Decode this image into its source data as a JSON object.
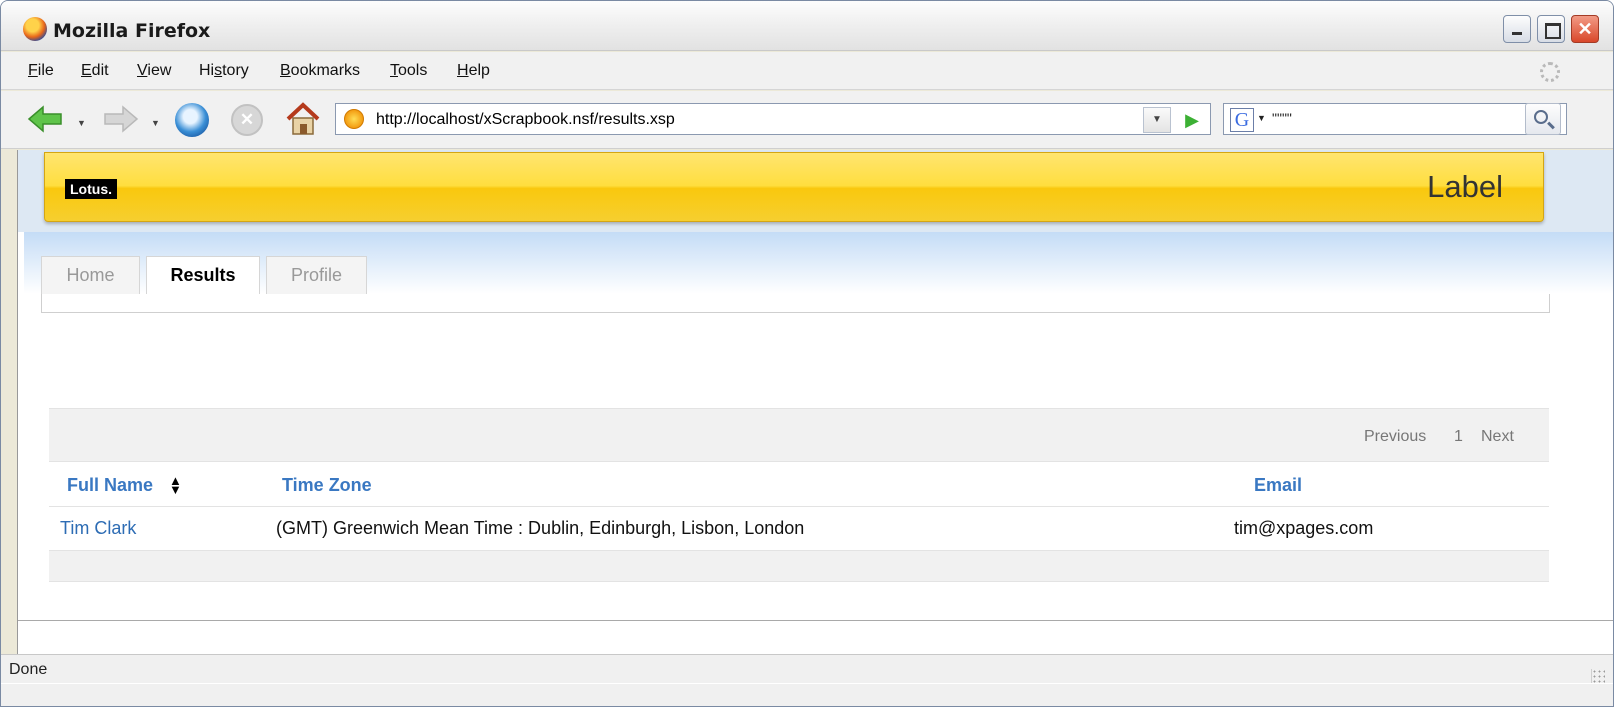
{
  "window": {
    "title": "Mozilla Firefox"
  },
  "menu": {
    "items": [
      {
        "pre": "",
        "u": "F",
        "post": "ile"
      },
      {
        "pre": "",
        "u": "E",
        "post": "dit"
      },
      {
        "pre": "",
        "u": "V",
        "post": "iew"
      },
      {
        "pre": "Hi",
        "u": "s",
        "post": "tory"
      },
      {
        "pre": "",
        "u": "B",
        "post": "ookmarks"
      },
      {
        "pre": "",
        "u": "T",
        "post": "ools"
      },
      {
        "pre": "",
        "u": "H",
        "post": "elp"
      }
    ]
  },
  "navigation": {
    "url": "http://localhost/xScrapbook.nsf/results.xsp",
    "search_value": "\"\"\"\""
  },
  "banner": {
    "logo": "Lotus.",
    "label": "Label"
  },
  "tabs": [
    {
      "label": "Home",
      "active": false
    },
    {
      "label": "Results",
      "active": true
    },
    {
      "label": "Profile",
      "active": false
    }
  ],
  "pager": {
    "previous": "Previous",
    "page": "1",
    "next": "Next"
  },
  "table": {
    "columns": [
      "Full Name",
      "Time Zone",
      "Email"
    ],
    "rows": [
      {
        "full_name": "Tim Clark",
        "time_zone": "(GMT) Greenwich Mean Time : Dublin, Edinburgh, Lisbon, London",
        "email": "tim@xpages.com"
      }
    ]
  },
  "status": {
    "text": "Done"
  },
  "icons": {
    "app": "firefox-icon",
    "back": "back-arrow-icon",
    "forward": "forward-arrow-icon",
    "reload": "reload-icon",
    "stop": "stop-icon",
    "home": "home-icon",
    "site": "site-favicon-icon",
    "search_engine": "google-icon",
    "search": "magnifier-icon",
    "sort": "sort-icon"
  }
}
